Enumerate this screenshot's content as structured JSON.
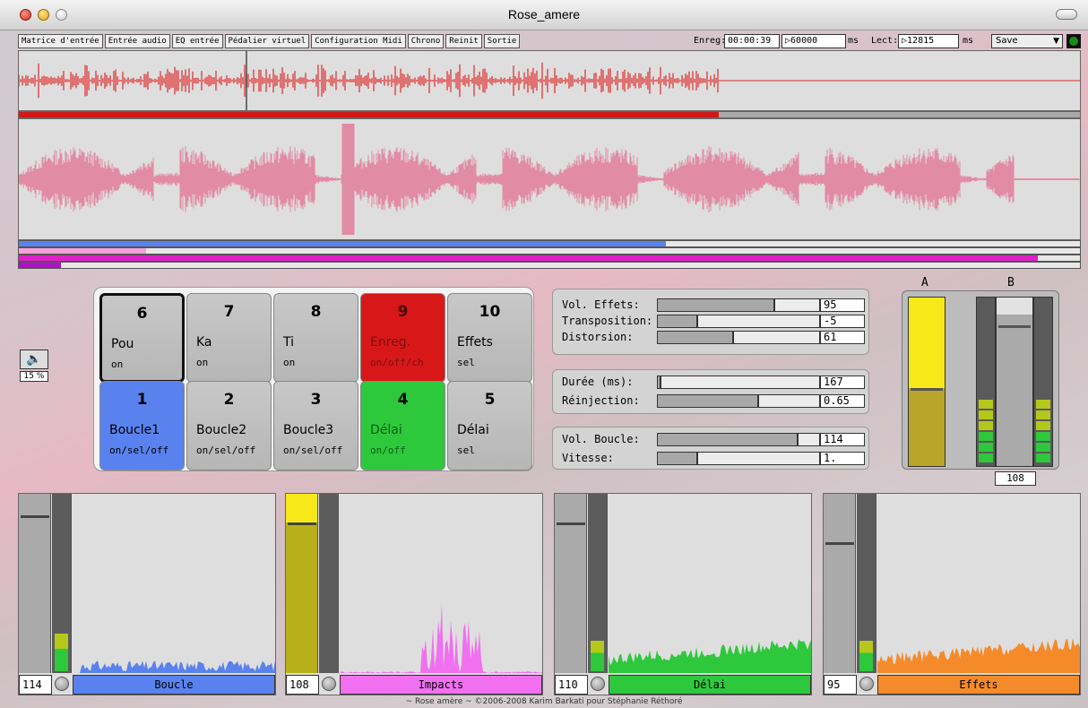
{
  "window": {
    "title": "Rose_amere"
  },
  "menu": [
    "Matrice d'entrée",
    "Entrée audio",
    "EQ entrée",
    "Pédalier virtuel",
    "Configuration Midi",
    "Chrono",
    "Reinit",
    "Sortie"
  ],
  "record": {
    "label": "Enreg:",
    "time": "00:00:39",
    "length": "60000",
    "unit": "ms"
  },
  "playback": {
    "label": "Lect:",
    "position": "12815",
    "unit": "ms"
  },
  "save_select": "Save",
  "progress": {
    "record_fraction": 0.66,
    "blue_fraction": 0.61,
    "light_fraction": 0.12,
    "magenta_fraction": 0.96,
    "purple_fraction": 0.04
  },
  "colors": {
    "record_wave": "#e02a2a",
    "loop_wave": "#e28ba6",
    "record_bar": "#d01818",
    "blue": "#5a82ee",
    "pink": "#f070c8",
    "magenta": "#e020c8",
    "green": "#2ec83c",
    "orange": "#f58a2a"
  },
  "volume": {
    "icon": "speaker-icon",
    "percent": "15 %"
  },
  "pads": [
    {
      "num": "6",
      "label": "Pou",
      "sub": "on",
      "style": "selected"
    },
    {
      "num": "7",
      "label": "Ka",
      "sub": "on",
      "style": "grey"
    },
    {
      "num": "8",
      "label": "Ti",
      "sub": "on",
      "style": "grey"
    },
    {
      "num": "9",
      "label": "Enreg.",
      "sub": "on/off/ch",
      "style": "red"
    },
    {
      "num": "10",
      "label": "Effets",
      "sub": "sel",
      "style": "grey"
    },
    {
      "num": "1",
      "label": "Boucle1",
      "sub": "on/sel/off",
      "style": "blue"
    },
    {
      "num": "2",
      "label": "Boucle2",
      "sub": "on/sel/off",
      "style": "grey"
    },
    {
      "num": "3",
      "label": "Boucle3",
      "sub": "on/sel/off",
      "style": "grey"
    },
    {
      "num": "4",
      "label": "Délai",
      "sub": "on/off",
      "style": "green"
    },
    {
      "num": "5",
      "label": "Délai",
      "sub": "sel",
      "style": "grey"
    }
  ],
  "params": {
    "effects": [
      {
        "label": "Vol. Effets:",
        "value": "95",
        "level": 0.73
      },
      {
        "label": "Transposition:",
        "value": "-5",
        "level": 0.25
      },
      {
        "label": "Distorsion:",
        "value": "61",
        "level": 0.47
      }
    ],
    "delay": [
      {
        "label": "Durée (ms):",
        "value": "167",
        "level": 0.02
      },
      {
        "label": "Réinjection:",
        "value": "0.65",
        "level": 0.63
      }
    ],
    "loop": [
      {
        "label": "Vol. Boucle:",
        "value": "114",
        "level": 0.87
      },
      {
        "label": "Vitesse:",
        "value": "1.",
        "level": 0.25
      }
    ]
  },
  "master": {
    "a_label": "A",
    "b_label": "B",
    "a_level": 0.47,
    "b_level": 0.9,
    "b_value": "108"
  },
  "channels": [
    {
      "name": "Boucle",
      "value": "114",
      "color": "#5a82ee",
      "fader": 0.88,
      "meter": 0.35
    },
    {
      "name": "Impacts",
      "value": "108",
      "color": "#f070f0",
      "fader": 0.84,
      "meter": 0
    },
    {
      "name": "Délai",
      "value": "110",
      "color": "#2ec83c",
      "fader": 0.84,
      "meter": 0.28
    },
    {
      "name": "Effets",
      "value": "95",
      "color": "#f58a2a",
      "fader": 0.73,
      "meter": 0.28
    }
  ],
  "footer": "~ Rose amère ~  ©2006-2008 Karim Barkati pour Stéphanie Réthoré"
}
